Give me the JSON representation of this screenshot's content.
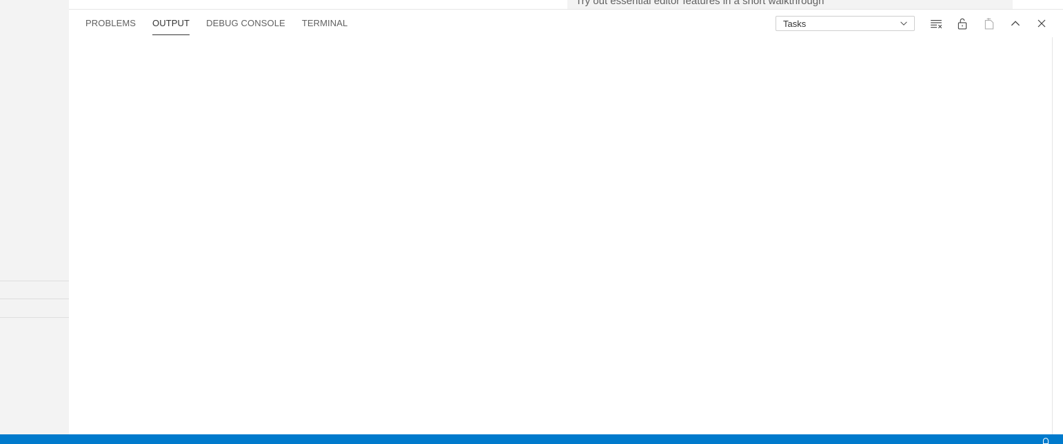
{
  "editor": {
    "walkthrough_text": "Try out essential editor features in a short walkthrough"
  },
  "panel": {
    "tabs": [
      {
        "label": "PROBLEMS",
        "active": false
      },
      {
        "label": "OUTPUT",
        "active": true
      },
      {
        "label": "DEBUG CONSOLE",
        "active": false
      },
      {
        "label": "TERMINAL",
        "active": false
      }
    ],
    "output_channel": {
      "selected": "Tasks"
    },
    "actions": [
      {
        "icon": "clear-output-icon"
      },
      {
        "icon": "unlock-scroll-icon"
      },
      {
        "icon": "open-log-file-icon"
      },
      {
        "icon": "chevron-up-icon"
      },
      {
        "icon": "close-icon"
      }
    ]
  },
  "statusbar": {
    "color": "#007acc",
    "icon": "bell-icon"
  }
}
